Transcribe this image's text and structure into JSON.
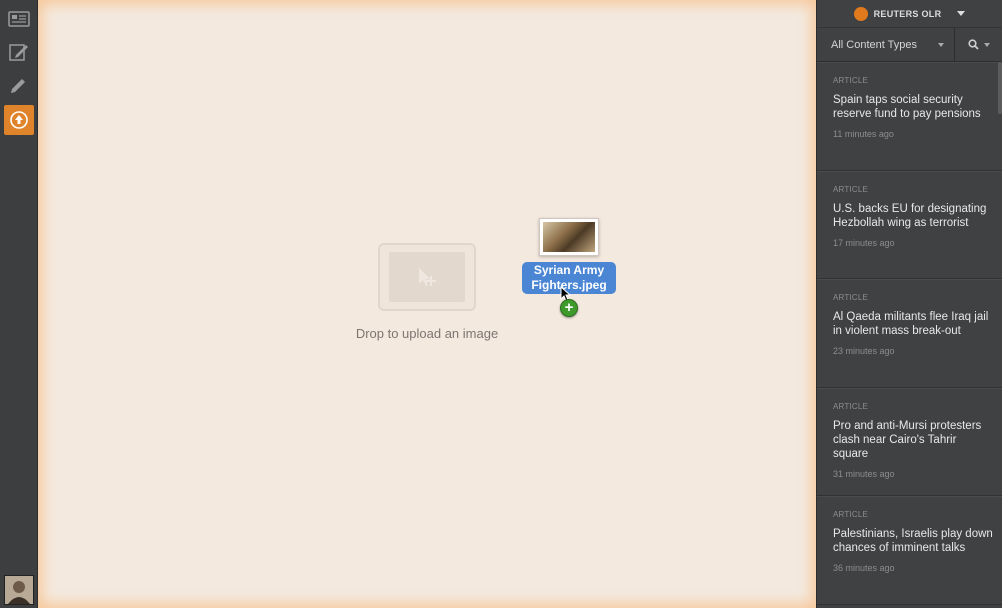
{
  "panel": {
    "brand": "REUTERS OLR",
    "filter_label": "All Content Types"
  },
  "dropzone": {
    "label": "Drop to upload an image",
    "drag_file_name": "Syrian Army Fighters.jpeg"
  },
  "feed": [
    {
      "type": "ARTICLE",
      "title": "Spain taps social security reserve fund to pay pensions",
      "time": "11 minutes ago"
    },
    {
      "type": "ARTICLE",
      "title": "U.S. backs EU for designating Hezbollah wing as terrorist",
      "time": "17 minutes ago"
    },
    {
      "type": "ARTICLE",
      "title": "Al Qaeda militants flee Iraq jail in violent mass break-out",
      "time": "23 minutes ago"
    },
    {
      "type": "ARTICLE",
      "title": "Pro and anti-Mursi protesters clash near Cairo's Tahrir square",
      "time": "31 minutes ago"
    },
    {
      "type": "ARTICLE",
      "title": "Palestinians, Israelis play down chances of imminent talks",
      "time": "36 minutes ago"
    }
  ],
  "icons": {
    "rail": [
      "news-list-icon",
      "compose-icon",
      "pencil-icon",
      "upload-icon"
    ],
    "accent": "#e0842c"
  }
}
